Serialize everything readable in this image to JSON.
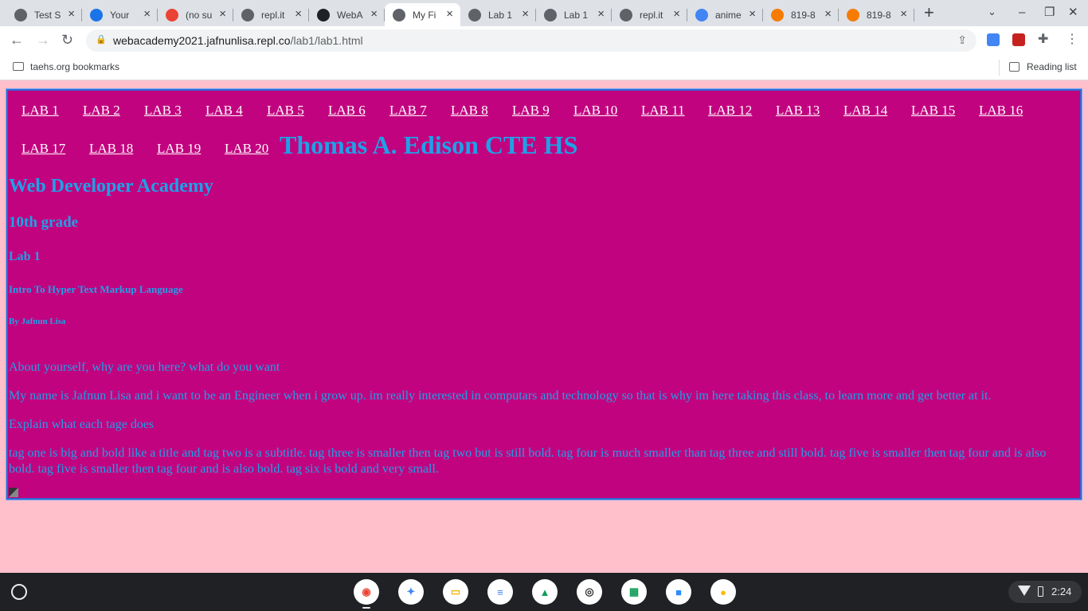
{
  "tabs": [
    {
      "title": "Test S",
      "icon": "globe-icon",
      "color": "#5f6368"
    },
    {
      "title": "Your",
      "icon": "contacts-icon",
      "color": "#1a73e8"
    },
    {
      "title": "(no su",
      "icon": "gmail-icon",
      "color": "#ea4335"
    },
    {
      "title": "repl.it",
      "icon": "globe-icon",
      "color": "#5f6368"
    },
    {
      "title": "WebA",
      "icon": "openai-icon",
      "color": "#202124"
    },
    {
      "title": "My Fi",
      "icon": "globe-icon",
      "color": "#5f6368",
      "active": true
    },
    {
      "title": "Lab 1",
      "icon": "globe-icon",
      "color": "#5f6368"
    },
    {
      "title": "Lab 1",
      "icon": "globe-icon",
      "color": "#5f6368"
    },
    {
      "title": "repl.it",
      "icon": "globe-icon",
      "color": "#5f6368"
    },
    {
      "title": "anime",
      "icon": "google-icon",
      "color": "#4285f4"
    },
    {
      "title": "819-8",
      "icon": "search-icon",
      "color": "#f57c00"
    },
    {
      "title": "819-8",
      "icon": "search-icon",
      "color": "#f57c00"
    }
  ],
  "address_bar": {
    "domain": "webacademy2021.jafnunlisa.repl.co",
    "path": "/lab1/lab1.html"
  },
  "bookmarks": {
    "folder_label": "taehs.org bookmarks",
    "reading_list_label": "Reading list"
  },
  "page": {
    "lab_links": [
      "LAB 1",
      "LAB 2",
      "LAB 3",
      "LAB 4",
      "LAB 5",
      "LAB 6",
      "LAB 7",
      "LAB 8",
      "LAB 9",
      "LAB 10",
      "LAB 11",
      "LAB 12",
      "LAB 13",
      "LAB 14",
      "LAB 15",
      "LAB 16",
      "LAB 17",
      "LAB 18",
      "LAB 19",
      "LAB 20"
    ],
    "school_name": "Thomas A. Edison CTE HS",
    "h2": "Web Developer Academy",
    "h3": "10th grade",
    "h4": "Lab 1",
    "h5": "Intro To Hyper Text Markup Language",
    "h6": "By Jafnun Lisa",
    "question1": "About yourself, why are you here? what do you want",
    "answer1": "My name is Jafnun Lisa and i want to be an Engineer when i grow up. im really interested in computars and technology so that is why im here taking this class, to learn more and get better at it.",
    "question2": "Explain what each tage does",
    "answer2": "tag one is big and bold like a title and tag two is a subtitle. tag three is smaller then tag two but is still bold. tag four is much smaller than tag three and still bold. tag five is smaller then tag four and is also bold. tag five is smaller then tag four and is also bold. tag six is bold and very small."
  },
  "shelf": {
    "apps": [
      "chrome-icon",
      "classlink-icon",
      "slides-icon",
      "docs-icon",
      "drive-icon",
      "geogebra-icon",
      "sheets-icon",
      "zoom-icon",
      "keep-icon"
    ],
    "time": "2:24"
  },
  "colors": {
    "page_background": "#ffc0cb",
    "content_background": "#c2037f",
    "heading_color": "#1ea1e8",
    "link_color": "#ffffff"
  }
}
